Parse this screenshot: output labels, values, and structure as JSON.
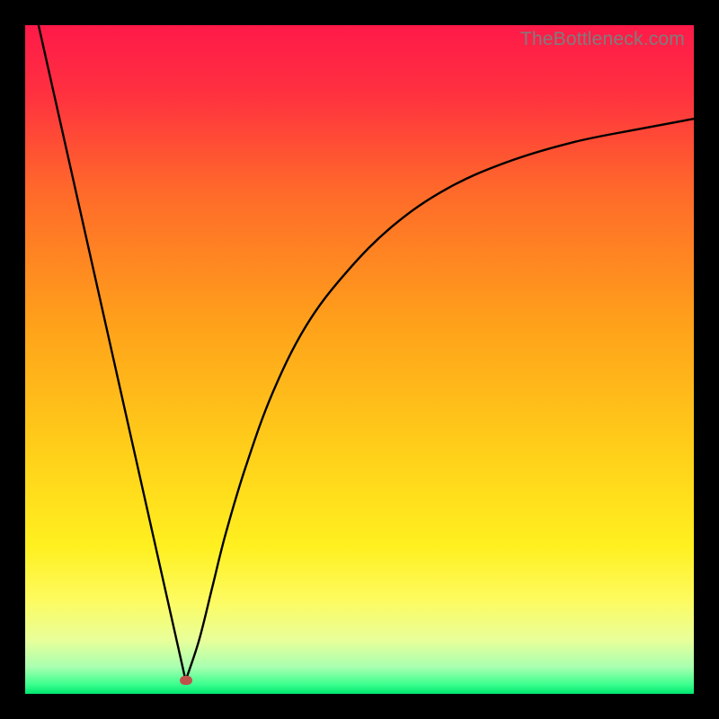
{
  "watermark": "TheBottleneck.com",
  "chart_data": {
    "type": "line",
    "title": "",
    "xlabel": "",
    "ylabel": "",
    "xlim": [
      0,
      100
    ],
    "ylim": [
      0,
      100
    ],
    "background_gradient_stops": [
      {
        "offset": 0.0,
        "color": "#ff1a49"
      },
      {
        "offset": 0.1,
        "color": "#ff3040"
      },
      {
        "offset": 0.25,
        "color": "#ff6a2a"
      },
      {
        "offset": 0.45,
        "color": "#ffa21a"
      },
      {
        "offset": 0.65,
        "color": "#ffd21a"
      },
      {
        "offset": 0.78,
        "color": "#fff020"
      },
      {
        "offset": 0.86,
        "color": "#fdfb60"
      },
      {
        "offset": 0.92,
        "color": "#e8ff9a"
      },
      {
        "offset": 0.96,
        "color": "#a8ffb0"
      },
      {
        "offset": 0.985,
        "color": "#40ff90"
      },
      {
        "offset": 1.0,
        "color": "#00e870"
      }
    ],
    "series": [
      {
        "name": "left-branch",
        "x": [
          2,
          24
        ],
        "y": [
          100,
          2
        ]
      },
      {
        "name": "right-branch",
        "x": [
          24,
          26,
          28,
          30,
          33,
          37,
          42,
          48,
          55,
          63,
          72,
          82,
          92,
          100
        ],
        "y": [
          2,
          8,
          16,
          24,
          34,
          45,
          55,
          63,
          70,
          75.5,
          79.5,
          82.5,
          84.5,
          86
        ]
      }
    ],
    "marker": {
      "x": 24,
      "y": 2,
      "color": "#c0524c"
    }
  }
}
